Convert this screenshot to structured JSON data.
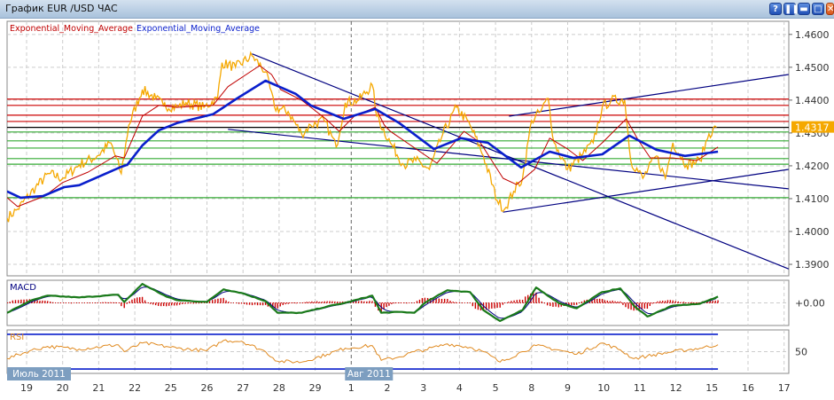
{
  "window": {
    "title": "График EUR /USD  ЧАС",
    "buttons": [
      {
        "name": "help",
        "glyph": "?"
      },
      {
        "name": "pause",
        "glyph": "❚❚"
      },
      {
        "name": "minimize",
        "glyph": "▬"
      },
      {
        "name": "maximize",
        "glyph": "□"
      },
      {
        "name": "close",
        "glyph": "✕"
      }
    ]
  },
  "colors": {
    "price": "#f5a800",
    "ema_fast": "#c00000",
    "ema_slow": "#0a1fcc",
    "trendline": "#000080",
    "resistance": "#cc0000",
    "support": "#33aa33",
    "current": "#000000",
    "macd": "#1a7a1a",
    "macd_signal": "#000080",
    "macd_hist": "#cc0000",
    "rsi": "#e08a20",
    "badge": "#f5a800"
  },
  "chart_data": [
    {
      "type": "line",
      "panel": "price",
      "title": "",
      "legend": [
        "Exponential_Moving_Average",
        "Exponential_Moving_Average"
      ],
      "legend_position": "top-left",
      "ylim": [
        1.3865,
        1.464
      ],
      "yticks": [
        "1.4600",
        "1.4500",
        "1.4400",
        "1.4300",
        "1.4200",
        "1.4100",
        "1.4000",
        "1.3900"
      ],
      "grid": true,
      "current_price": "1.4317",
      "series": [
        {
          "key": "price",
          "points": [
            [
              "07-18 11:00",
              1.4041
            ],
            [
              "07-18 18:00",
              1.4068
            ],
            [
              "07-19 06:00",
              1.4135
            ],
            [
              "07-19 15:00",
              1.4176
            ],
            [
              "07-20 00:00",
              1.4162
            ],
            [
              "07-20 11:00",
              1.4203
            ],
            [
              "07-20 23:00",
              1.423
            ],
            [
              "07-21 08:00",
              1.427
            ],
            [
              "07-21 15:00",
              1.4176
            ],
            [
              "07-21 20:00",
              1.4324
            ],
            [
              "07-22 05:00",
              1.4432
            ],
            [
              "07-22 14:00",
              1.4405
            ],
            [
              "07-22 19:00",
              1.4384
            ],
            [
              "07-25 04:00",
              1.4378
            ],
            [
              "07-25 10:00",
              1.4392
            ],
            [
              "07-25 22:00",
              1.4378
            ],
            [
              "07-26 07:00",
              1.4405
            ],
            [
              "07-26 10:00",
              1.4514
            ],
            [
              "07-26 19:00",
              1.45
            ],
            [
              "07-27 06:00",
              1.4535
            ],
            [
              "07-27 15:00",
              1.4486
            ],
            [
              "07-27 21:00",
              1.4378
            ],
            [
              "07-28 06:00",
              1.4365
            ],
            [
              "07-28 15:00",
              1.4297
            ],
            [
              "07-28 21:00",
              1.4324
            ],
            [
              "07-29 06:00",
              1.4338
            ],
            [
              "07-29 14:00",
              1.4257
            ],
            [
              "07-29 20:00",
              1.4392
            ],
            [
              "08-01 05:00",
              1.44
            ],
            [
              "08-01 14:00",
              1.4446
            ],
            [
              "08-01 17:00",
              1.4351
            ],
            [
              "08-02 02:00",
              1.427
            ],
            [
              "08-02 11:00",
              1.4203
            ],
            [
              "08-02 19:00",
              1.4216
            ],
            [
              "08-03 04:00",
              1.4189
            ],
            [
              "08-03 13:00",
              1.4297
            ],
            [
              "08-03 22:00",
              1.4378
            ],
            [
              "08-04 07:00",
              1.4324
            ],
            [
              "08-04 16:00",
              1.423
            ],
            [
              "08-05 01:00",
              1.4095
            ],
            [
              "08-05 06:00",
              1.4068
            ],
            [
              "08-05 12:00",
              1.4122
            ],
            [
              "08-05 18:00",
              1.4162
            ],
            [
              "08-08 00:00",
              1.4338
            ],
            [
              "08-08 06:00",
              1.4365
            ],
            [
              "08-08 11:00",
              1.4405
            ],
            [
              "08-08 15:00",
              1.427
            ],
            [
              "08-09 00:00",
              1.4189
            ],
            [
              "08-09 09:00",
              1.423
            ],
            [
              "08-09 17:00",
              1.427
            ],
            [
              "08-09 23:00",
              1.4378
            ],
            [
              "08-10 05:00",
              1.44
            ],
            [
              "08-10 14:00",
              1.44
            ],
            [
              "08-10 18:00",
              1.4216
            ],
            [
              "08-11 02:00",
              1.4162
            ],
            [
              "08-11 11:00",
              1.423
            ],
            [
              "08-11 17:00",
              1.4162
            ],
            [
              "08-11 22:00",
              1.427
            ],
            [
              "08-12 07:00",
              1.4203
            ],
            [
              "08-12 16:00",
              1.4216
            ],
            [
              "08-12 22:00",
              1.4297
            ],
            [
              "08-15 03:00",
              1.4317
            ]
          ]
        },
        {
          "key": "ema_fast",
          "name": "Exponential_Moving_Average",
          "points": [
            [
              "07-18 11:00",
              1.4103
            ],
            [
              "07-18 18:00",
              1.4076
            ],
            [
              "07-19 12:00",
              1.4108
            ],
            [
              "07-20 00:00",
              1.4149
            ],
            [
              "07-20 17:00",
              1.4181
            ],
            [
              "07-21 11:00",
              1.423
            ],
            [
              "07-21 17:00",
              1.4224
            ],
            [
              "07-22 05:00",
              1.4351
            ],
            [
              "07-22 16:00",
              1.4384
            ],
            [
              "07-25 04:00",
              1.4378
            ],
            [
              "07-26 04:00",
              1.4384
            ],
            [
              "07-26 14:00",
              1.4441
            ],
            [
              "07-27 11:00",
              1.4505
            ],
            [
              "07-27 19:00",
              1.4478
            ],
            [
              "07-28 01:00",
              1.4432
            ],
            [
              "07-28 15:00",
              1.44
            ],
            [
              "07-29 07:00",
              1.4343
            ],
            [
              "07-29 16:00",
              1.4305
            ],
            [
              "08-01 02:00",
              1.4351
            ],
            [
              "08-01 16:00",
              1.4378
            ],
            [
              "08-01 22:00",
              1.4324
            ],
            [
              "08-02 02:00",
              1.4305
            ],
            [
              "08-03 09:00",
              1.4208
            ],
            [
              "08-03 17:00",
              1.4251
            ],
            [
              "08-04 03:00",
              1.4305
            ],
            [
              "08-04 14:00",
              1.427
            ],
            [
              "08-05 05:00",
              1.4162
            ],
            [
              "08-05 14:00",
              1.4143
            ],
            [
              "08-08 02:00",
              1.4189
            ],
            [
              "08-08 12:00",
              1.4284
            ],
            [
              "08-09 00:00",
              1.4251
            ],
            [
              "08-09 10:00",
              1.4216
            ],
            [
              "08-09 23:00",
              1.427
            ],
            [
              "08-10 15:00",
              1.4343
            ],
            [
              "08-10 23:00",
              1.4278
            ],
            [
              "08-11 07:00",
              1.4224
            ],
            [
              "08-11 22:00",
              1.4224
            ],
            [
              "08-12 14:00",
              1.4216
            ],
            [
              "08-15 04:00",
              1.4257
            ]
          ]
        },
        {
          "key": "ema_slow",
          "name": "Exponential_Moving_Average",
          "points": [
            [
              "07-18 11:00",
              1.4122
            ],
            [
              "07-18 20:00",
              1.4103
            ],
            [
              "07-19 11:00",
              1.4108
            ],
            [
              "07-20 01:00",
              1.4135
            ],
            [
              "07-20 11:00",
              1.4141
            ],
            [
              "07-21 15:00",
              1.4197
            ],
            [
              "07-21 19:00",
              1.4203
            ],
            [
              "07-22 05:00",
              1.4262
            ],
            [
              "07-22 16:00",
              1.4308
            ],
            [
              "07-25 04:00",
              1.433
            ],
            [
              "07-26 04:00",
              1.4357
            ],
            [
              "07-26 20:00",
              1.4405
            ],
            [
              "07-27 15:00",
              1.4459
            ],
            [
              "07-28 11:00",
              1.4419
            ],
            [
              "07-28 21:00",
              1.4384
            ],
            [
              "07-29 19:00",
              1.4343
            ],
            [
              "08-01 16:00",
              1.4373
            ],
            [
              "08-02 08:00",
              1.433
            ],
            [
              "08-03 07:00",
              1.4251
            ],
            [
              "08-04 01:00",
              1.4284
            ],
            [
              "08-04 19:00",
              1.427
            ],
            [
              "08-05 17:00",
              1.4195
            ],
            [
              "08-08 12:00",
              1.4243
            ],
            [
              "08-09 04:00",
              1.4224
            ],
            [
              "08-09 23:00",
              1.4235
            ],
            [
              "08-10 17:00",
              1.4292
            ],
            [
              "08-11 11:00",
              1.4249
            ],
            [
              "08-12 06:00",
              1.423
            ],
            [
              "08-15 04:00",
              1.4243
            ]
          ]
        }
      ],
      "horizontal_levels": {
        "resistance": [
          1.4403,
          1.4384,
          1.4354,
          1.4335
        ],
        "current": [
          1.4317
        ],
        "support": [
          1.4303,
          1.4276,
          1.4254,
          1.4222,
          1.4205,
          1.4103
        ]
      },
      "trendlines": [
        [
          [
            "07-27 06:00",
            1.4541
          ],
          [
            "08-17 03:00",
            1.3886
          ]
        ],
        [
          [
            "07-26 14:00",
            1.4311
          ],
          [
            "08-17 03:00",
            1.413
          ]
        ],
        [
          [
            "08-05 09:00",
            1.4351
          ],
          [
            "08-17 03:00",
            1.4478
          ]
        ],
        [
          [
            "08-05 05:00",
            1.4059
          ],
          [
            "08-17 03:00",
            1.4189
          ]
        ]
      ]
    },
    {
      "type": "line",
      "panel": "macd",
      "title": "MACD",
      "ylim": [
        -0.0025,
        0.0025
      ],
      "yticks": [
        "+0.00"
      ],
      "grid": true,
      "points": [
        [
          "07-18 11:00",
          -0.0011
        ],
        [
          "07-19 02:00",
          0.0002
        ],
        [
          "07-19 14:00",
          0.0008
        ],
        [
          "07-20 11:00",
          0.0006
        ],
        [
          "07-21 13:00",
          0.0009
        ],
        [
          "07-21 17:00",
          0.0001
        ],
        [
          "07-22 05:00",
          0.0021
        ],
        [
          "07-22 21:00",
          0.0007
        ],
        [
          "07-25 04:00",
          0.0003
        ],
        [
          "07-26 00:00",
          0.0001
        ],
        [
          "07-26 11:00",
          0.0015
        ],
        [
          "07-26 23:00",
          0.0011
        ],
        [
          "07-27 15:00",
          0.0002
        ],
        [
          "07-27 23:00",
          -0.0011
        ],
        [
          "07-28 15:00",
          -0.0011
        ],
        [
          "07-29 08:00",
          -0.0004
        ],
        [
          "07-29 20:00",
          0.0
        ],
        [
          "08-01 14:00",
          0.0008
        ],
        [
          "08-01 20:00",
          -0.0011
        ],
        [
          "08-02 08:00",
          -0.001
        ],
        [
          "08-02 18:00",
          -0.0011
        ],
        [
          "08-03 01:00",
          0.0
        ],
        [
          "08-03 16:00",
          0.0014
        ],
        [
          "08-04 07:00",
          0.0012
        ],
        [
          "08-04 16:00",
          -0.0008
        ],
        [
          "08-05 03:00",
          -0.002
        ],
        [
          "08-05 18:00",
          -0.0008
        ],
        [
          "08-08 03:00",
          0.0017
        ],
        [
          "08-08 18:00",
          0.0
        ],
        [
          "08-09 06:00",
          -0.0006
        ],
        [
          "08-09 23:00",
          0.0012
        ],
        [
          "08-10 11:00",
          0.0016
        ],
        [
          "08-10 20:00",
          -0.0003
        ],
        [
          "08-11 05:00",
          -0.0015
        ],
        [
          "08-11 22:00",
          -0.0003
        ],
        [
          "08-12 16:00",
          -0.0001
        ],
        [
          "08-15 04:00",
          0.0007
        ]
      ]
    },
    {
      "type": "line",
      "panel": "rsi",
      "title": "RSI",
      "ylim": [
        25,
        75
      ],
      "levels": [
        70,
        30
      ],
      "yticks": [
        "50"
      ],
      "grid": true,
      "points": [
        [
          "07-18 11:00",
          42
        ],
        [
          "07-19 02:00",
          51
        ],
        [
          "07-19 14:00",
          56
        ],
        [
          "07-20 11:00",
          53
        ],
        [
          "07-21 13:00",
          58
        ],
        [
          "07-21 17:00",
          50
        ],
        [
          "07-22 05:00",
          60
        ],
        [
          "07-22 21:00",
          56
        ],
        [
          "07-25 04:00",
          54
        ],
        [
          "07-26 00:00",
          51
        ],
        [
          "07-26 11:00",
          63
        ],
        [
          "07-26 23:00",
          62
        ],
        [
          "07-27 15:00",
          50
        ],
        [
          "07-27 23:00",
          39
        ],
        [
          "07-28 15:00",
          38
        ],
        [
          "07-29 08:00",
          47
        ],
        [
          "07-29 20:00",
          54
        ],
        [
          "08-01 14:00",
          57
        ],
        [
          "08-01 20:00",
          40
        ],
        [
          "08-02 08:00",
          44
        ],
        [
          "08-02 18:00",
          50
        ],
        [
          "08-03 01:00",
          52
        ],
        [
          "08-03 16:00",
          59
        ],
        [
          "08-04 07:00",
          55
        ],
        [
          "08-04 16:00",
          50
        ],
        [
          "08-05 03:00",
          38
        ],
        [
          "08-05 18:00",
          50
        ],
        [
          "08-08 03:00",
          57
        ],
        [
          "08-08 18:00",
          52
        ],
        [
          "08-09 06:00",
          47
        ],
        [
          "08-09 23:00",
          60
        ],
        [
          "08-10 11:00",
          52
        ],
        [
          "08-10 20:00",
          42
        ],
        [
          "08-11 05:00",
          45
        ],
        [
          "08-11 22:00",
          50
        ],
        [
          "08-12 16:00",
          54
        ],
        [
          "08-15 04:00",
          58
        ]
      ]
    }
  ],
  "xaxis": {
    "days": [
      {
        "date": "07-19",
        "label": "19"
      },
      {
        "date": "07-20",
        "label": "20"
      },
      {
        "date": "07-21",
        "label": "21"
      },
      {
        "date": "07-22",
        "label": "22"
      },
      {
        "date": "07-25",
        "label": "25"
      },
      {
        "date": "07-26",
        "label": "26"
      },
      {
        "date": "07-27",
        "label": "27"
      },
      {
        "date": "07-28",
        "label": "28"
      },
      {
        "date": "07-29",
        "label": "29"
      },
      {
        "date": "08-01",
        "label": "1"
      },
      {
        "date": "08-02",
        "label": "2"
      },
      {
        "date": "08-03",
        "label": "3"
      },
      {
        "date": "08-04",
        "label": "4"
      },
      {
        "date": "08-05",
        "label": "5"
      },
      {
        "date": "08-08",
        "label": "8"
      },
      {
        "date": "08-09",
        "label": "9"
      },
      {
        "date": "08-10",
        "label": "10"
      },
      {
        "date": "08-11",
        "label": "11"
      },
      {
        "date": "08-12",
        "label": "12"
      },
      {
        "date": "08-15",
        "label": "15"
      },
      {
        "date": "08-16",
        "label": "16"
      },
      {
        "date": "08-17",
        "label": "17"
      }
    ],
    "months": [
      {
        "date": "07-19",
        "label": "Июль 2011"
      },
      {
        "date": "08-01",
        "label": "Авг 2011"
      }
    ]
  }
}
